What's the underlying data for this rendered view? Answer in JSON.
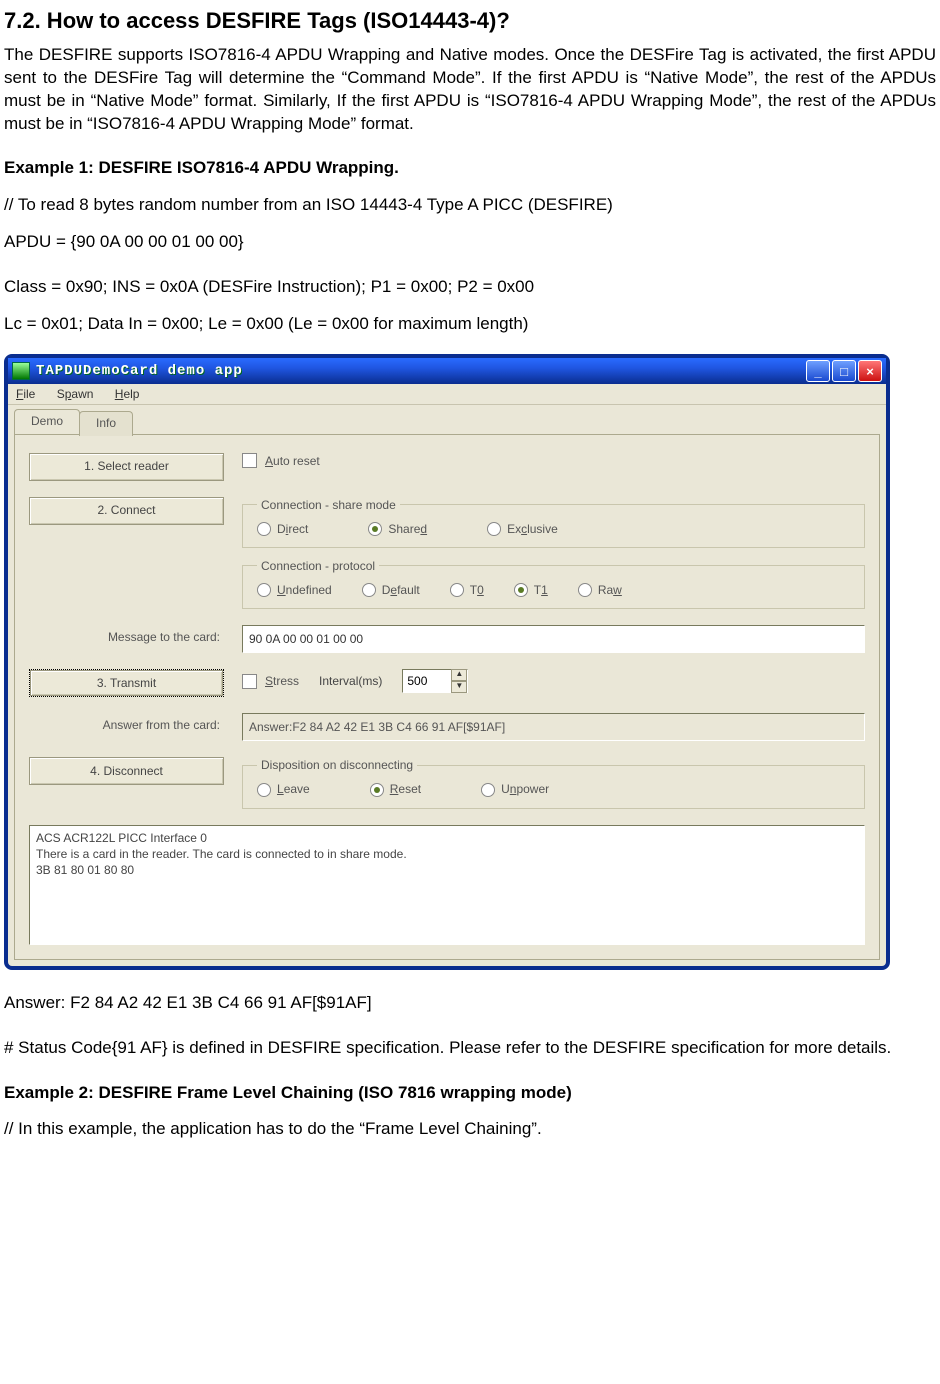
{
  "doc": {
    "heading": "7.2.   How to access DESFIRE Tags (ISO14443-4)?",
    "para1": "The DESFIRE supports ISO7816-4 APDU Wrapping and Native modes. Once the DESFire Tag is activated, the first APDU sent to the DESFire Tag will determine the “Command Mode”. If the first APDU is “Native Mode”, the rest of the APDUs must be in “Native Mode” format. Similarly, If the first APDU is “ISO7816-4 APDU Wrapping Mode”, the rest of the APDUs must be in “ISO7816-4 APDU Wrapping Mode” format.",
    "ex1_title": "Example 1: DESFIRE ISO7816-4 APDU Wrapping.",
    "ex1_l1": "// To read 8 bytes random number from an ISO 14443-4 Type A PICC (DESFIRE)",
    "ex1_l2": "APDU = {90 0A 00 00 01 00 00}",
    "ex1_l3": "Class = 0x90; INS = 0x0A (DESFire Instruction);  P1 = 0x00;  P2 = 0x00",
    "ex1_l4": "Lc = 0x01; Data In = 0x00; Le = 0x00 (Le = 0x00 for maximum length)",
    "answer_line": "Answer: F2 84 A2 42 E1 3B C4 66 91 AF[$91AF]",
    "status_note": "# Status Code{91 AF} is defined in DESFIRE specification. Please refer to the DESFIRE specification for more details.",
    "ex2_title": "Example 2:  DESFIRE Frame Level Chaining (ISO 7816 wrapping mode)",
    "ex2_l1": "// In this example, the application has to do the “Frame Level Chaining”."
  },
  "app": {
    "title": "TAPDUDemoCard demo app",
    "menu": {
      "file": "File",
      "spawn": "Spawn",
      "help": "Help"
    },
    "tabs": {
      "demo": "Demo",
      "info": "Info"
    },
    "buttons": {
      "select_reader": "1. Select reader",
      "connect": "2. Connect",
      "transmit": "3. Transmit",
      "disconnect": "4. Disconnect"
    },
    "labels": {
      "auto_reset": "Auto reset",
      "conn_share": "Connection - share mode",
      "direct": "Direct",
      "shared": "Shared",
      "exclusive": "Exclusive",
      "conn_proto": "Connection - protocol",
      "undefined": "Undefined",
      "default": "Default",
      "t0": "T0",
      "t1": "T1",
      "raw": "Raw",
      "msg_to_card": "Message to the card:",
      "stress": "Stress",
      "interval": "Interval(ms)",
      "answer_from": "Answer from the card:",
      "disposition": "Disposition on disconnecting",
      "leave": "Leave",
      "reset": "Reset",
      "unpower": "Unpower"
    },
    "fields": {
      "message": "90 0A 00 00 01 00 00",
      "interval": "500",
      "answer": "Answer:F2 84 A2 42 E1 3B C4 66 91 AF[$91AF]"
    },
    "log": "ACS ACR122L PICC Interface 0\nThere is a card in the reader. The card is connected to in share mode.\n3B 81 80 01 80 80"
  }
}
